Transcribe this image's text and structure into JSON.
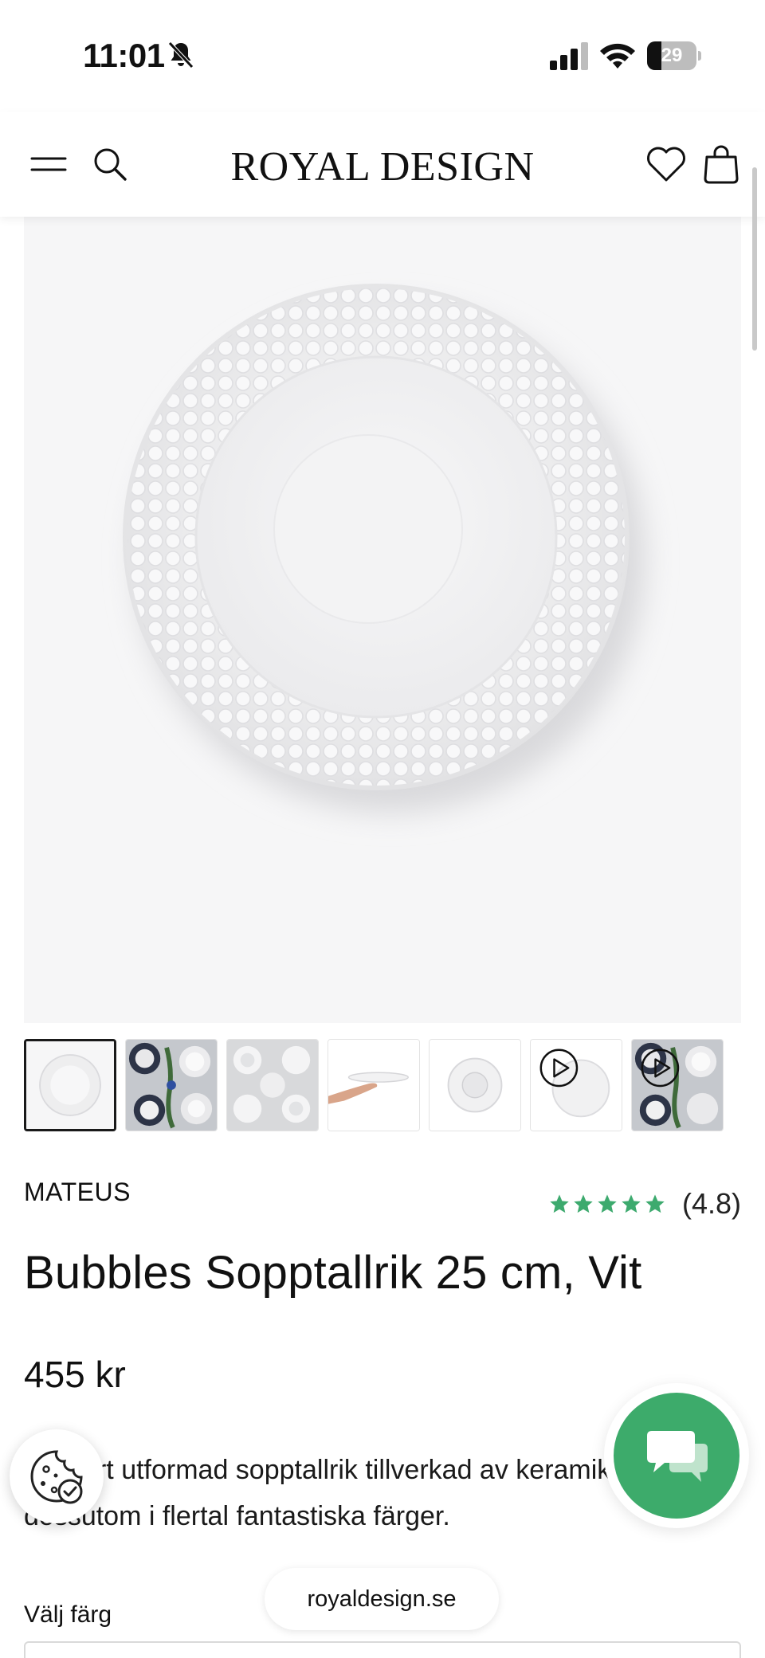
{
  "status_bar": {
    "time": "11:01",
    "battery": "29",
    "battery_level": 0.29,
    "icons": [
      "bell-slash-icon",
      "cellular-signal-icon",
      "wifi-icon",
      "battery-icon"
    ]
  },
  "header": {
    "brand_logo": "ROYAL DESIGN",
    "icons": [
      "menu-icon",
      "search-icon",
      "heart-icon",
      "shopping-bag-icon"
    ]
  },
  "gallery": {
    "thumbnail_count": 7,
    "selected_index": 0,
    "thumbnails": [
      {
        "kind": "plate-front",
        "video": false
      },
      {
        "kind": "table-setting-blue",
        "video": false
      },
      {
        "kind": "table-setting-white",
        "video": false
      },
      {
        "kind": "plate-on-hand",
        "video": false
      },
      {
        "kind": "plate-underside",
        "video": false
      },
      {
        "kind": "plate-video",
        "video": true
      },
      {
        "kind": "table-setting-video",
        "video": true
      }
    ]
  },
  "product": {
    "brand": "MATEUS",
    "rating_stars": 5,
    "rating_text": "(4.8)",
    "title": "Bubbles Sopptallrik 25 cm, Vit",
    "price": "455 kr",
    "description": "Vackert utformad sopptallrik tillverkad av keramik, finns dessutom i flertal fantastiska färger.",
    "color_label": "Välj färg"
  },
  "overlay": {
    "url": "royaldesign.se"
  },
  "colors": {
    "accent_green": "#3dab6b",
    "star_green": "#3daa6e",
    "hero_background": "#f6f6f7"
  }
}
